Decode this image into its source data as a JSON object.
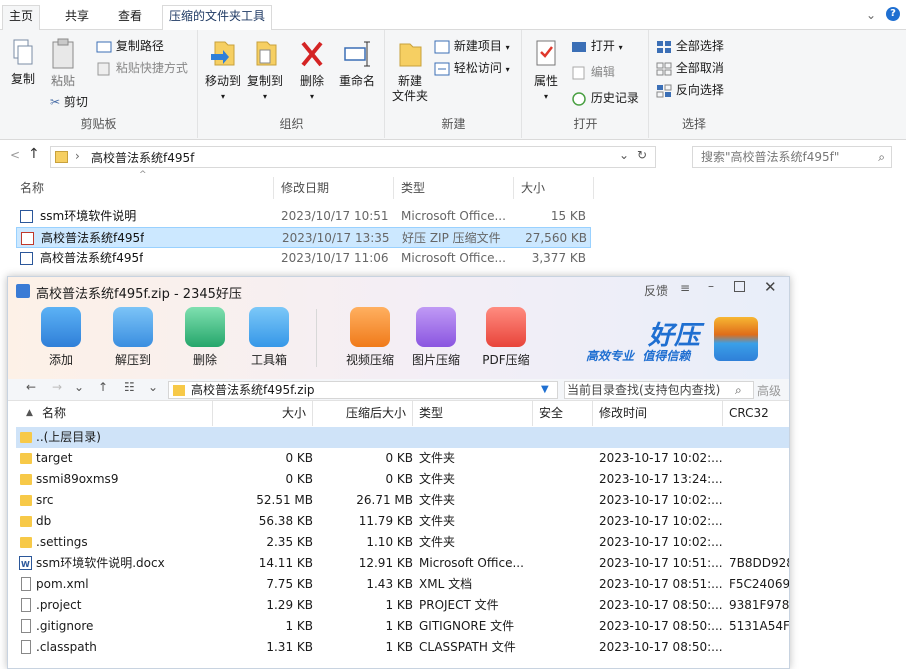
{
  "ribbon_tabs": {
    "home": "主页",
    "share": "共享",
    "view": "查看",
    "tools": "压缩的文件夹工具"
  },
  "ribbon": {
    "clipboard": {
      "copy": "复制",
      "paste": "粘贴",
      "copy_path": "复制路径",
      "paste_shortcut": "粘贴快捷方式",
      "cut": "剪切",
      "label": "剪贴板"
    },
    "organize": {
      "move_to": "移动到",
      "copy_to": "复制到",
      "delete": "删除",
      "rename": "重命名",
      "label": "组织"
    },
    "new": {
      "new_folder": "新建\n文件夹",
      "new_item": "新建项目",
      "easy_access": "轻松访问",
      "label": "新建"
    },
    "open": {
      "properties": "属性",
      "open": "打开",
      "edit": "编辑",
      "history": "历史记录",
      "label": "打开"
    },
    "select": {
      "select_all": "全部选择",
      "select_none": "全部取消",
      "invert": "反向选择",
      "label": "选择"
    }
  },
  "address": {
    "path": "高校普法系统f495f",
    "search_placeholder": "搜索\"高校普法系统f495f\""
  },
  "explorer": {
    "columns": {
      "name": "名称",
      "date": "修改日期",
      "type": "类型",
      "size": "大小"
    },
    "rows": [
      {
        "name": "ssm环境软件说明",
        "date": "2023/10/17 10:51",
        "type": "Microsoft Office...",
        "size": "15 KB"
      },
      {
        "name": "高校普法系统f495f",
        "date": "2023/10/17 13:35",
        "type": "好压 ZIP 压缩文件",
        "size": "27,560 KB"
      },
      {
        "name": "高校普法系统f495f",
        "date": "2023/10/17 11:06",
        "type": "Microsoft Office...",
        "size": "3,377 KB"
      }
    ]
  },
  "haozip": {
    "title": "高校普法系统f495f.zip - 2345好压",
    "feedback": "反馈",
    "toolbar": {
      "add": "添加",
      "extract": "解压到",
      "delete": "删除",
      "toolbox": "工具箱",
      "video": "视频压缩",
      "image": "图片压缩",
      "pdf": "PDF压缩"
    },
    "brand": {
      "name": "好压",
      "slogan": "高效专业  值得信赖"
    },
    "path": "高校普法系统f495f.zip",
    "search_placeholder": "当前目录查找(支持包内查找)",
    "advanced": "高级",
    "columns": {
      "name": "名称",
      "size": "大小",
      "packed": "压缩后大小",
      "type": "类型",
      "security": "安全",
      "modified": "修改时间",
      "crc": "CRC32"
    },
    "rows": [
      {
        "name": "..(上层目录)",
        "size": "",
        "packed": "",
        "type": "",
        "modified": "",
        "crc": "",
        "kind": "folder"
      },
      {
        "name": "target",
        "size": "0 KB",
        "packed": "0 KB",
        "type": "文件夹",
        "modified": "2023-10-17 10:02:...",
        "crc": "",
        "kind": "folder"
      },
      {
        "name": "ssmi89oxms9",
        "size": "0 KB",
        "packed": "0 KB",
        "type": "文件夹",
        "modified": "2023-10-17 13:24:...",
        "crc": "",
        "kind": "folder"
      },
      {
        "name": "src",
        "size": "52.51 MB",
        "packed": "26.71 MB",
        "type": "文件夹",
        "modified": "2023-10-17 10:02:...",
        "crc": "",
        "kind": "folder"
      },
      {
        "name": "db",
        "size": "56.38 KB",
        "packed": "11.79 KB",
        "type": "文件夹",
        "modified": "2023-10-17 10:02:...",
        "crc": "",
        "kind": "folder"
      },
      {
        "name": ".settings",
        "size": "2.35 KB",
        "packed": "1.10 KB",
        "type": "文件夹",
        "modified": "2023-10-17 10:02:...",
        "crc": "",
        "kind": "folder"
      },
      {
        "name": "ssm环境软件说明.docx",
        "size": "14.11 KB",
        "packed": "12.91 KB",
        "type": "Microsoft Office...",
        "modified": "2023-10-17 10:51:...",
        "crc": "7B8DD928",
        "kind": "docx"
      },
      {
        "name": "pom.xml",
        "size": "7.75 KB",
        "packed": "1.43 KB",
        "type": "XML 文档",
        "modified": "2023-10-17 08:51:...",
        "crc": "F5C24069",
        "kind": "file"
      },
      {
        "name": ".project",
        "size": "1.29 KB",
        "packed": "1 KB",
        "type": "PROJECT 文件",
        "modified": "2023-10-17 08:50:...",
        "crc": "9381F978",
        "kind": "file"
      },
      {
        "name": ".gitignore",
        "size": "1 KB",
        "packed": "1 KB",
        "type": "GITIGNORE 文件",
        "modified": "2023-10-17 08:50:...",
        "crc": "5131A54F",
        "kind": "file"
      },
      {
        "name": ".classpath",
        "size": "1.31 KB",
        "packed": "1 KB",
        "type": "CLASSPATH 文件",
        "modified": "2023-10-17 08:50:...",
        "crc": "",
        "kind": "file"
      }
    ]
  }
}
